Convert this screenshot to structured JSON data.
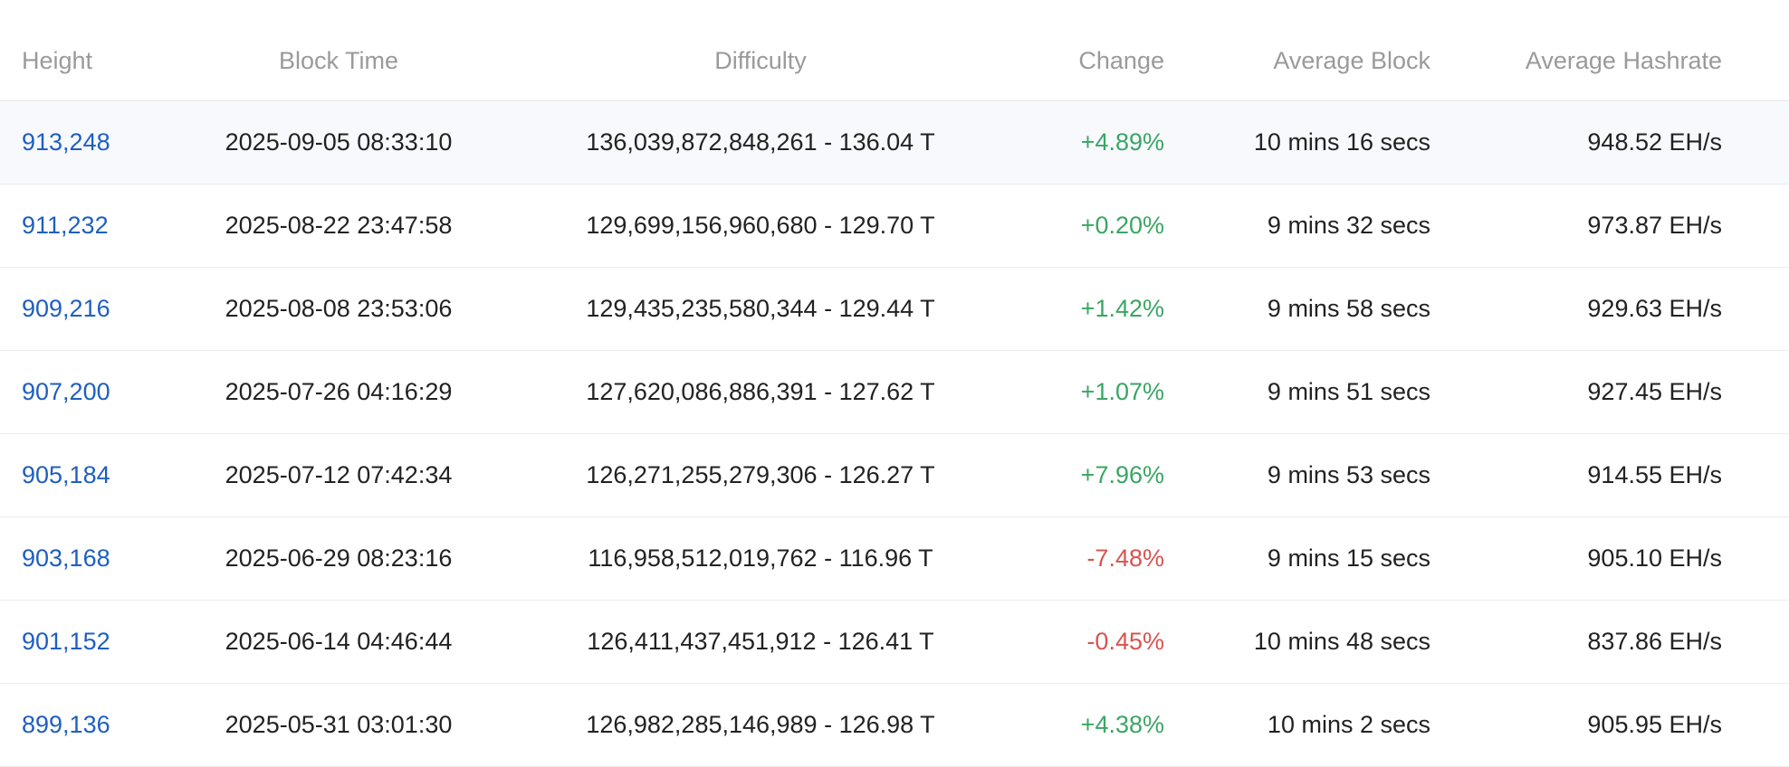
{
  "table": {
    "headers": {
      "height": "Height",
      "block_time": "Block Time",
      "difficulty": "Difficulty",
      "change": "Change",
      "average_block": "Average Block",
      "average_hashrate": "Average Hashrate"
    },
    "rows": [
      {
        "height": "913,248",
        "block_time": "2025-09-05 08:33:10",
        "difficulty": "136,039,872,848,261 - 136.04 T",
        "change": "+4.89%",
        "change_dir": "pos",
        "average_block": "10 mins 16 secs",
        "average_hashrate": "948.52 EH/s"
      },
      {
        "height": "911,232",
        "block_time": "2025-08-22 23:47:58",
        "difficulty": "129,699,156,960,680 - 129.70 T",
        "change": "+0.20%",
        "change_dir": "pos",
        "average_block": "9 mins 32 secs",
        "average_hashrate": "973.87 EH/s"
      },
      {
        "height": "909,216",
        "block_time": "2025-08-08 23:53:06",
        "difficulty": "129,435,235,580,344 - 129.44 T",
        "change": "+1.42%",
        "change_dir": "pos",
        "average_block": "9 mins 58 secs",
        "average_hashrate": "929.63 EH/s"
      },
      {
        "height": "907,200",
        "block_time": "2025-07-26 04:16:29",
        "difficulty": "127,620,086,886,391 - 127.62 T",
        "change": "+1.07%",
        "change_dir": "pos",
        "average_block": "9 mins 51 secs",
        "average_hashrate": "927.45 EH/s"
      },
      {
        "height": "905,184",
        "block_time": "2025-07-12 07:42:34",
        "difficulty": "126,271,255,279,306 - 126.27 T",
        "change": "+7.96%",
        "change_dir": "pos",
        "average_block": "9 mins 53 secs",
        "average_hashrate": "914.55 EH/s"
      },
      {
        "height": "903,168",
        "block_time": "2025-06-29 08:23:16",
        "difficulty": "116,958,512,019,762 - 116.96 T",
        "change": "-7.48%",
        "change_dir": "neg",
        "average_block": "9 mins 15 secs",
        "average_hashrate": "905.10 EH/s"
      },
      {
        "height": "901,152",
        "block_time": "2025-06-14 04:46:44",
        "difficulty": "126,411,437,451,912 - 126.41 T",
        "change": "-0.45%",
        "change_dir": "neg",
        "average_block": "10 mins 48 secs",
        "average_hashrate": "837.86 EH/s"
      },
      {
        "height": "899,136",
        "block_time": "2025-05-31 03:01:30",
        "difficulty": "126,982,285,146,989 - 126.98 T",
        "change": "+4.38%",
        "change_dir": "pos",
        "average_block": "10 mins 2 secs",
        "average_hashrate": "905.95 EH/s"
      }
    ]
  },
  "colors": {
    "link": "#1f5fbf",
    "positive": "#3aa663",
    "negative": "#d9534f",
    "header_text": "#9a9a9a",
    "highlight_row": "#f7f9fd"
  }
}
